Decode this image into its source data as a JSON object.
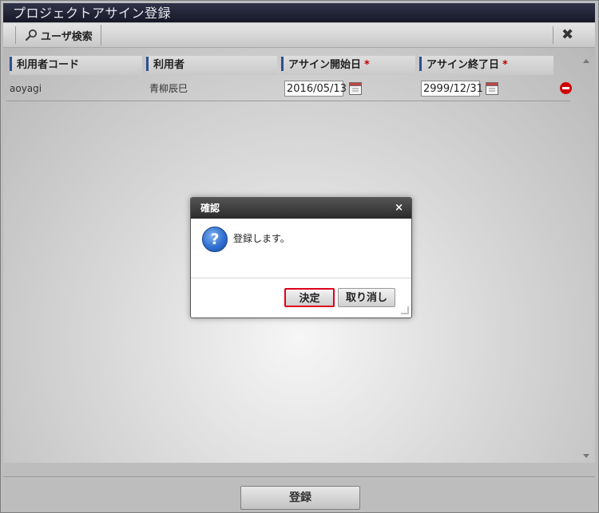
{
  "window": {
    "title": "プロジェクトアサイン登録"
  },
  "toolbar": {
    "search_label": "ユーザ検索"
  },
  "table": {
    "headers": {
      "user_code": "利用者コード",
      "user_name": "利用者",
      "start_date": "アサイン開始日",
      "end_date": "アサイン終了日",
      "required_mark": "*"
    },
    "rows": [
      {
        "user_code": "aoyagi",
        "user_name": "青柳辰巳",
        "start_date": "2016/05/13",
        "end_date": "2999/12/31"
      }
    ]
  },
  "footer": {
    "register_label": "登録"
  },
  "dialog": {
    "title": "確認",
    "close_glyph": "×",
    "message": "登録します。",
    "icon_glyph": "?",
    "ok_label": "決定",
    "cancel_label": "取り消し"
  },
  "icons": {
    "close": "close-icon",
    "search": "search-icon",
    "calendar": "calendar-icon",
    "remove": "remove-row-icon",
    "question": "question-icon"
  }
}
